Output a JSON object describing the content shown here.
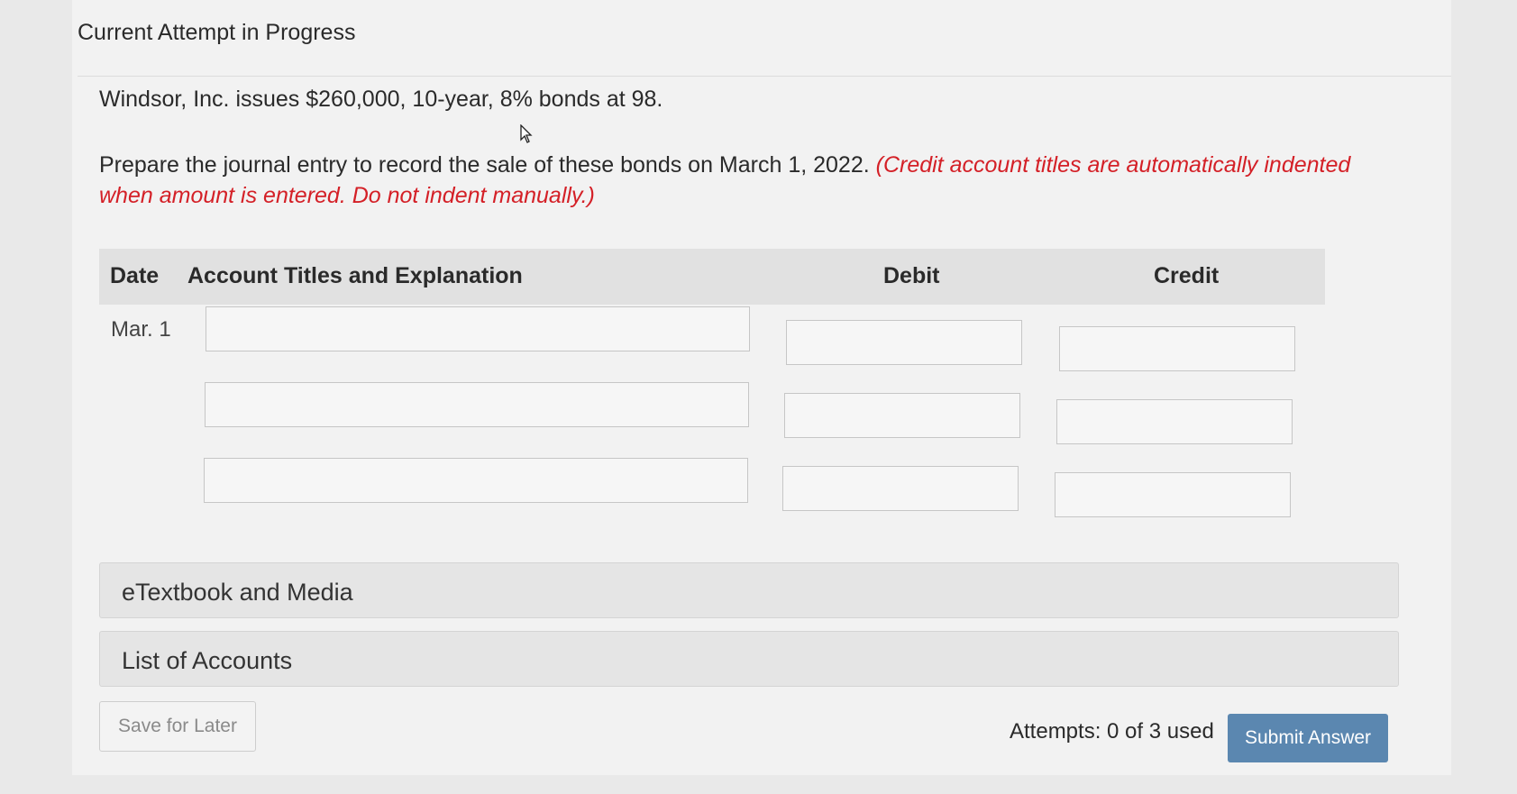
{
  "header": {
    "title": "Current Attempt in Progress"
  },
  "problem": {
    "statement": "Windsor, Inc. issues $260,000, 10-year, 8% bonds at 98.",
    "instruction": "Prepare the journal entry to record the sale of these bonds on March 1, 2022.",
    "note": "(Credit account titles are automatically indented when amount is entered. Do not indent manually.)"
  },
  "journal": {
    "columns": {
      "date": "Date",
      "account": "Account Titles and Explanation",
      "debit": "Debit",
      "credit": "Credit"
    },
    "date_value": "Mar. 1",
    "rows": [
      {
        "account": "",
        "debit": "",
        "credit": ""
      },
      {
        "account": "",
        "debit": "",
        "credit": ""
      },
      {
        "account": "",
        "debit": "",
        "credit": ""
      }
    ]
  },
  "panels": {
    "etextbook": "eTextbook and Media",
    "accounts": "List of Accounts"
  },
  "footer": {
    "save_label": "Save for Later",
    "attempts": "Attempts: 0 of 3 used",
    "submit_label": "Submit Answer"
  },
  "colors": {
    "note": "#d42027",
    "submit_button": "#5b87b0",
    "table_header": "#e1e1e1"
  },
  "icons": [
    "mouse-pointer-icon"
  ]
}
